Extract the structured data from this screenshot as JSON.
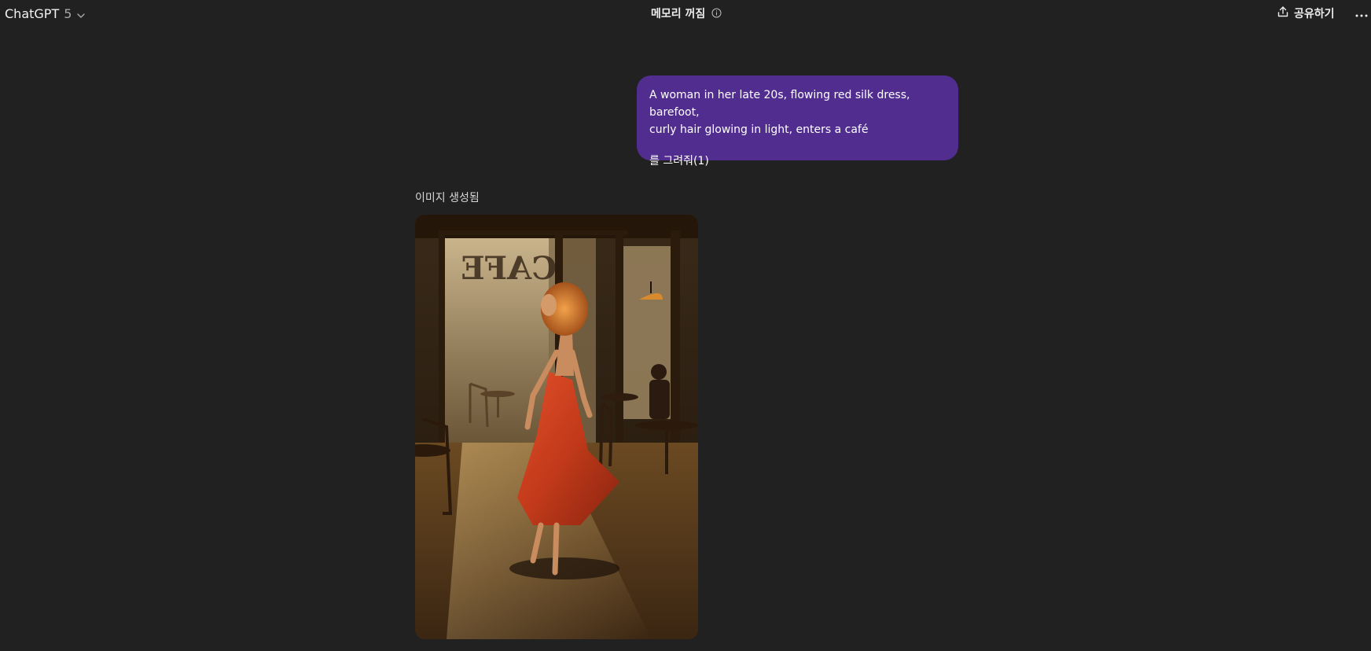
{
  "header": {
    "model_name": "ChatGPT",
    "model_version": "5",
    "memory_status": "메모리 꺼짐",
    "share_label": "공유하기"
  },
  "conversation": {
    "user_message": {
      "line1": "A woman in her late 20s, flowing red silk dress, barefoot,",
      "line2": "curly hair glowing in light, enters a café",
      "line3": "를 그려줘(1)"
    },
    "assistant": {
      "status_label": "이미지 생성됨",
      "image_sign_text": "CAFE"
    }
  },
  "colors": {
    "background": "#212121",
    "user_bubble": "#512d90",
    "text": "#ececec"
  },
  "icons": [
    "chevron-down-icon",
    "info-icon",
    "share-icon",
    "more-icon"
  ]
}
